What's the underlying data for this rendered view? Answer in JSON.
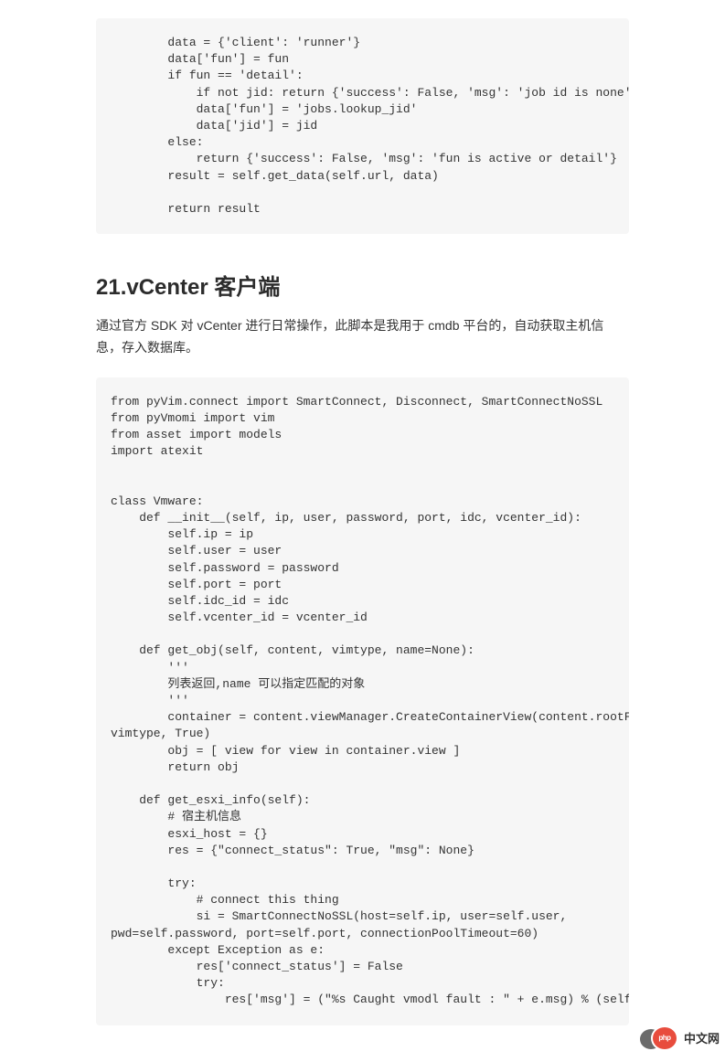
{
  "code_block_1": "        data = {'client': 'runner'}\n        data['fun'] = fun\n        if fun == 'detail':\n            if not jid: return {'success': False, 'msg': 'job id is none'}\n            data['fun'] = 'jobs.lookup_jid'\n            data['jid'] = jid\n        else:\n            return {'success': False, 'msg': 'fun is active or detail'}\n        result = self.get_data(self.url, data)\n\n        return result",
  "section_title": "21.vCenter 客户端",
  "section_desc": "通过官方 SDK 对 vCenter 进行日常操作，此脚本是我用于 cmdb 平台的，自动获取主机信息，存入数据库。",
  "code_block_2": "from pyVim.connect import SmartConnect, Disconnect, SmartConnectNoSSL\nfrom pyVmomi import vim\nfrom asset import models\nimport atexit\n\n\nclass Vmware:\n    def __init__(self, ip, user, password, port, idc, vcenter_id):\n        self.ip = ip\n        self.user = user\n        self.password = password\n        self.port = port\n        self.idc_id = idc\n        self.vcenter_id = vcenter_id\n\n    def get_obj(self, content, vimtype, name=None):\n        '''\n        列表返回,name 可以指定匹配的对象\n        '''\n        container = content.viewManager.CreateContainerView(content.rootFolder,\nvimtype, True)\n        obj = [ view for view in container.view ]\n        return obj\n\n    def get_esxi_info(self):\n        # 宿主机信息\n        esxi_host = {}\n        res = {\"connect_status\": True, \"msg\": None}\n\n        try:\n            # connect this thing\n            si = SmartConnectNoSSL(host=self.ip, user=self.user,\npwd=self.password, port=self.port, connectionPoolTimeout=60)\n        except Exception as e:\n            res['connect_status'] = False\n            try:\n                res['msg'] = (\"%s Caught vmodl fault : \" + e.msg) % (self.ip)",
  "watermark": {
    "badge_text": "php",
    "label": "中文网"
  }
}
